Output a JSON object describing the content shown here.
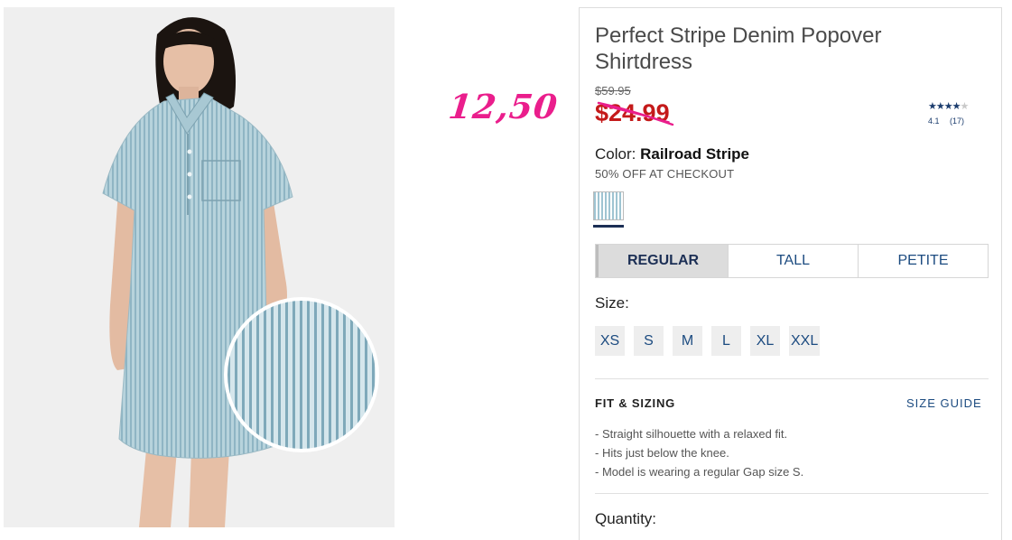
{
  "product": {
    "title": "Perfect Stripe Denim Popover Shirtdress",
    "original_price": "$59.95",
    "sale_price": "$24.99",
    "handwritten_price": "12,50",
    "rating": {
      "stars_filled": 4,
      "stars_total": 5,
      "score": "4.1",
      "count": "(17)"
    },
    "color_label": "Color:",
    "color_name": "Railroad Stripe",
    "promo": "50% OFF AT CHECKOUT",
    "swatch_name": "railroad-stripe-swatch"
  },
  "fit_tabs": [
    {
      "label": "REGULAR",
      "active": true
    },
    {
      "label": "TALL",
      "active": false
    },
    {
      "label": "PETITE",
      "active": false
    }
  ],
  "size": {
    "label": "Size:",
    "options": [
      "XS",
      "S",
      "M",
      "L",
      "XL",
      "XXL"
    ]
  },
  "fit_sizing": {
    "heading": "FIT & SIZING",
    "guide_link": "SIZE GUIDE",
    "details": [
      "- Straight silhouette with a relaxed fit.",
      "- Hits just below the knee.",
      "- Model is wearing a regular Gap size S."
    ]
  },
  "quantity": {
    "label": "Quantity:"
  },
  "colors": {
    "sale_red": "#c41a1a",
    "note_pink": "#ea1e8c",
    "link_blue": "#1c4b80",
    "denim": "#a9cad5"
  }
}
